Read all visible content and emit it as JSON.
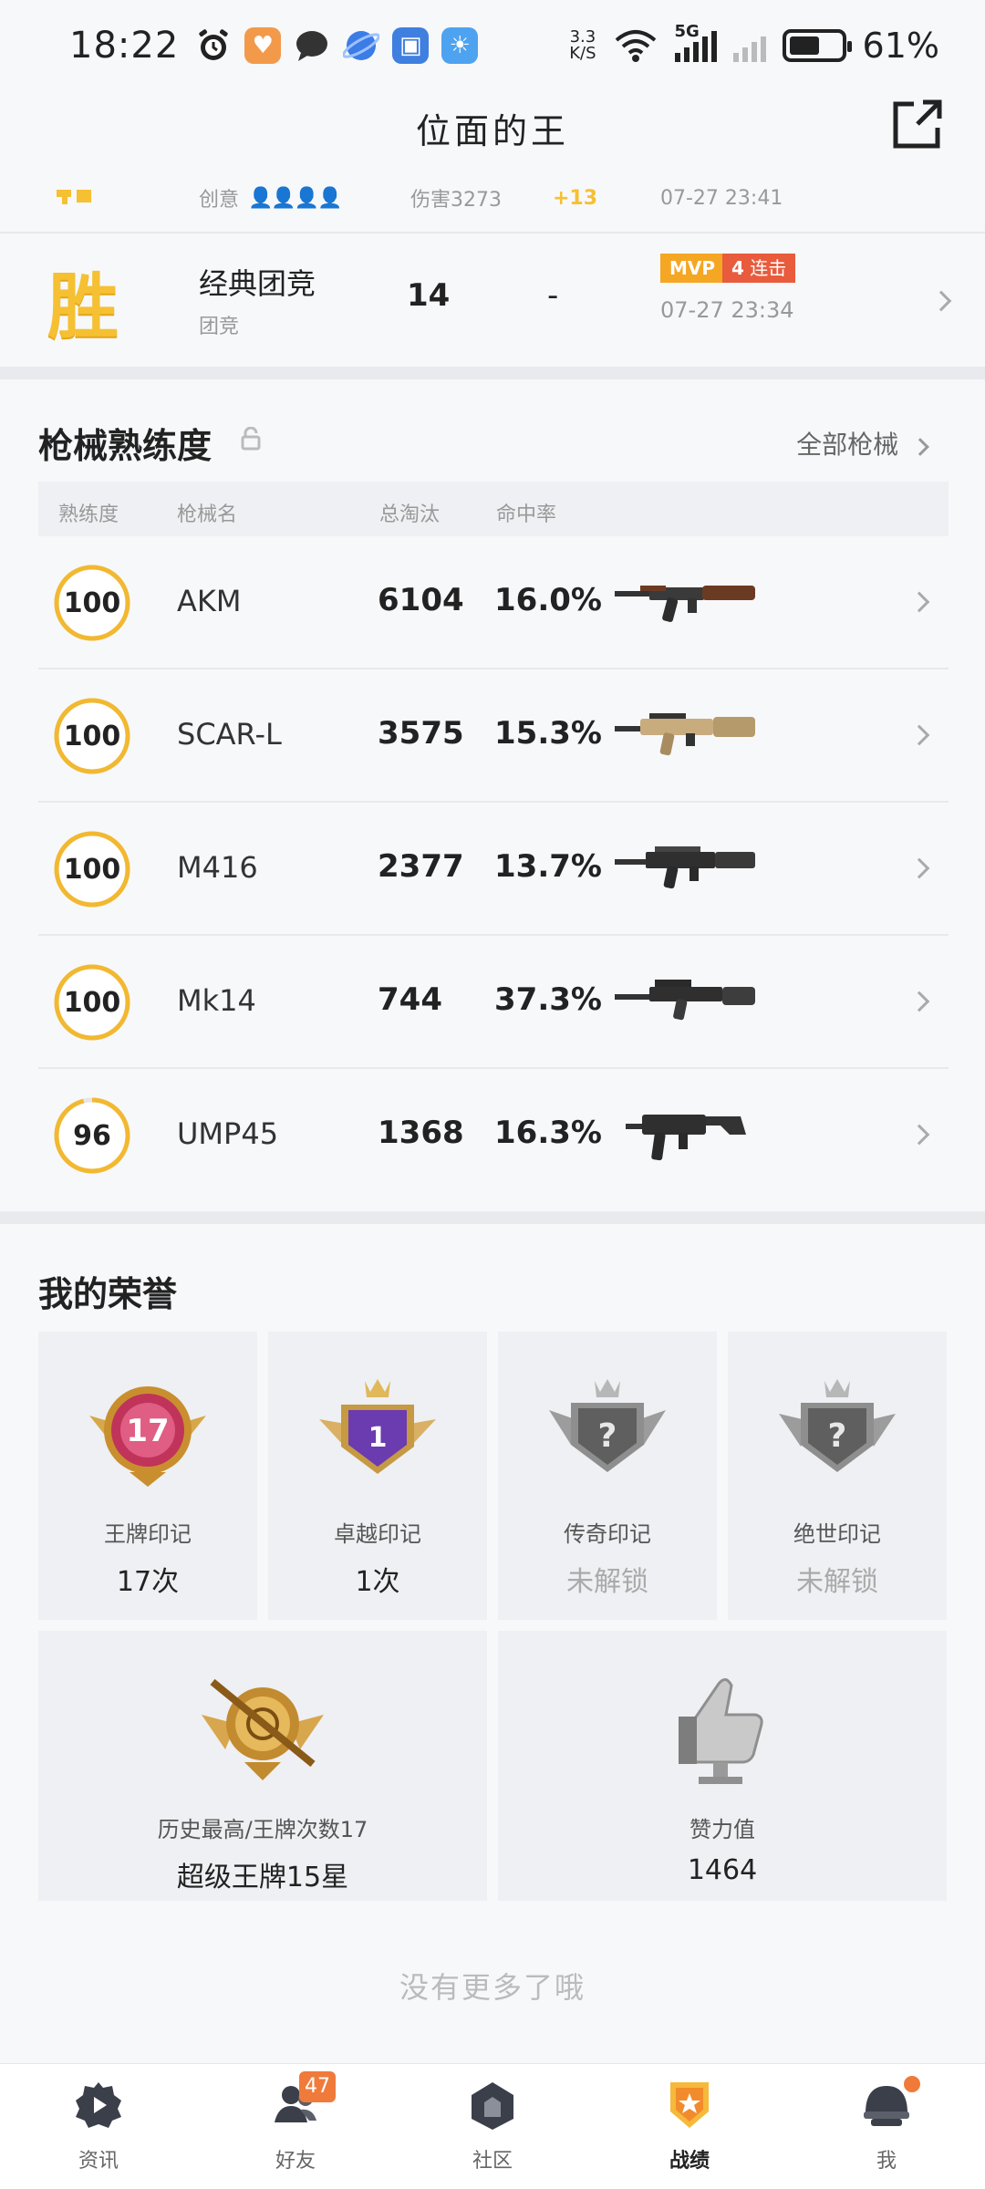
{
  "status_bar": {
    "time": "18:22",
    "net_speed_value": "3.3",
    "net_speed_unit": "K/S",
    "network_type": "5G",
    "battery_percent": "61%",
    "battery_level": 0.61
  },
  "header": {
    "title": "位面的王"
  },
  "matches": {
    "prev": {
      "mode": "创意",
      "damage": "伤害3273",
      "delta": "+13",
      "time": "07-27 23:41"
    },
    "current": {
      "result": "胜",
      "mode_name": "经典团竞",
      "mode_sub": "团竞",
      "rank": "14",
      "damage": "-",
      "tag_mvp": "MVP",
      "tag_streak_num": "4",
      "tag_streak_label": "连击",
      "time": "07-27 23:34"
    }
  },
  "weapons": {
    "title": "枪械熟练度",
    "all_link": "全部枪械",
    "columns": {
      "mastery": "熟练度",
      "name": "枪械名",
      "kills": "总淘汰",
      "accuracy": "命中率"
    },
    "rows": [
      {
        "mastery": "100",
        "mastery_level": 1.0,
        "name": "AKM",
        "kills": "6104",
        "accuracy": "16.0%"
      },
      {
        "mastery": "100",
        "mastery_level": 1.0,
        "name": "SCAR-L",
        "kills": "3575",
        "accuracy": "15.3%"
      },
      {
        "mastery": "100",
        "mastery_level": 1.0,
        "name": "M416",
        "kills": "2377",
        "accuracy": "13.7%"
      },
      {
        "mastery": "100",
        "mastery_level": 1.0,
        "name": "Mk14",
        "kills": "744",
        "accuracy": "37.3%"
      },
      {
        "mastery": "96",
        "mastery_level": 0.96,
        "name": "UMP45",
        "kills": "1368",
        "accuracy": "16.3%"
      }
    ]
  },
  "honors": {
    "title": "我的荣誉",
    "badges": [
      {
        "badge_text": "17",
        "name": "王牌印记",
        "value": "17次"
      },
      {
        "badge_text": "1",
        "name": "卓越印记",
        "value": "1次"
      },
      {
        "badge_text": "?",
        "name": "传奇印记",
        "value": "未解锁"
      },
      {
        "badge_text": "?",
        "name": "绝世印记",
        "value": "未解锁"
      }
    ],
    "wide": [
      {
        "name": "历史最高/王牌次数17",
        "value": "超级王牌15星"
      },
      {
        "name": "赞力值",
        "value": "1464"
      }
    ],
    "no_more": "没有更多了哦"
  },
  "bottom_nav": {
    "items": [
      {
        "label": "资讯"
      },
      {
        "label": "好友",
        "badge": "47"
      },
      {
        "label": "社区"
      },
      {
        "label": "战绩"
      },
      {
        "label": "我"
      }
    ],
    "active_index": 3
  },
  "colors": {
    "accent_gold": "#f6c033",
    "mvp_orange": "#f5a623",
    "streak_red": "#e85b3c",
    "badge_orange": "#f07a3a"
  }
}
